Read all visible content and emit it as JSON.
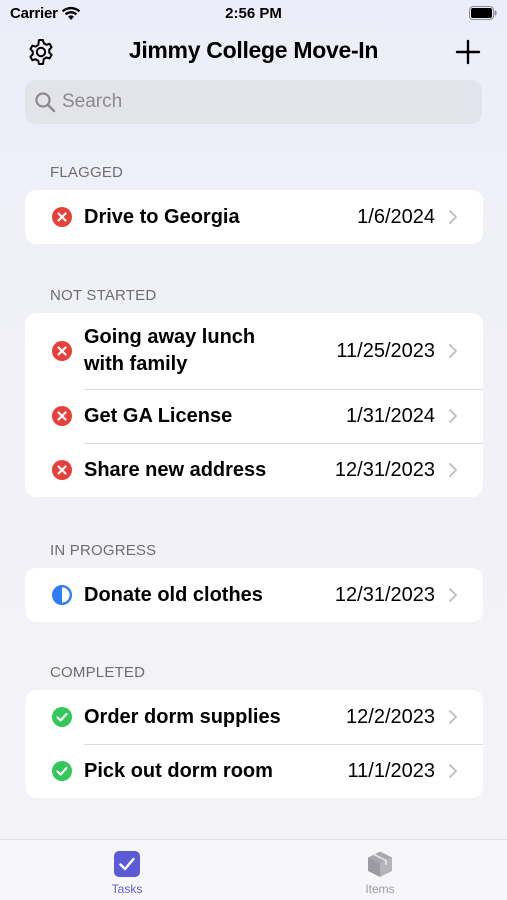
{
  "status_bar": {
    "carrier": "Carrier",
    "time": "2:56 PM"
  },
  "nav": {
    "title": "Jimmy College Move-In",
    "settings_icon": "gear-icon",
    "add_icon": "plus-icon"
  },
  "search": {
    "placeholder": "Search",
    "value": ""
  },
  "colors": {
    "accent": "#5b5bd6",
    "not_started": "#e5403a",
    "in_progress": "#2f7cf6",
    "completed": "#34c759"
  },
  "sections": {
    "flagged": {
      "header": "FLAGGED",
      "items": [
        {
          "title": "Drive to Georgia",
          "date": "1/6/2024",
          "status": "not-started"
        }
      ]
    },
    "not_started": {
      "header": "NOT STARTED",
      "items": [
        {
          "title": "Going away lunch with family",
          "date": "11/25/2023",
          "status": "not-started"
        },
        {
          "title": "Get GA License",
          "date": "1/31/2024",
          "status": "not-started"
        },
        {
          "title": "Share new address",
          "date": "12/31/2023",
          "status": "not-started"
        }
      ]
    },
    "in_progress": {
      "header": "IN PROGRESS",
      "items": [
        {
          "title": "Donate old clothes",
          "date": "12/31/2023",
          "status": "in-progress"
        }
      ]
    },
    "completed": {
      "header": "COMPLETED",
      "items": [
        {
          "title": "Order dorm supplies",
          "date": "12/2/2023",
          "status": "completed"
        },
        {
          "title": "Pick out dorm room",
          "date": "11/1/2023",
          "status": "completed"
        }
      ]
    }
  },
  "tab_bar": {
    "tasks": {
      "label": "Tasks",
      "icon": "checkbox-icon",
      "selected": true
    },
    "items": {
      "label": "Items",
      "icon": "box-icon",
      "selected": false
    }
  }
}
